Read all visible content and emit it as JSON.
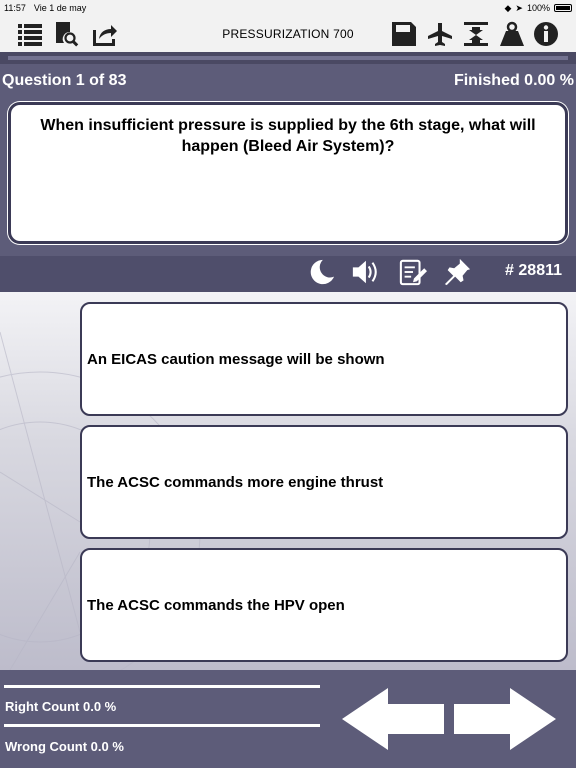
{
  "status_bar": {
    "time": "11:57",
    "date": "Vie 1 de may",
    "battery": "100%"
  },
  "toolbar": {
    "title": "PRESSURIZATION 700",
    "icons": [
      "list-icon",
      "document-search-icon",
      "share-icon",
      "save-icon",
      "airplane-icon",
      "compress-icon",
      "weight-icon",
      "info-icon"
    ]
  },
  "quiz": {
    "question_counter": "Question 1 of 83",
    "finished": "Finished 0.00 %",
    "question_text": "When insufficient pressure is supplied by the 6th stage, what will happen (Bleed Air System)?",
    "question_id": "# 28811"
  },
  "answers": [
    {
      "label": "An EICAS caution message will be shown"
    },
    {
      "label": "The ACSC commands more engine thrust"
    },
    {
      "label": "The ACSC commands the HPV open"
    }
  ],
  "stats": {
    "right_count": "Right Count 0.0  %",
    "wrong_count": "Wrong Count 0.0  %"
  },
  "colors": {
    "background": "#5d5c79",
    "box_border": "#3b3a56",
    "toolbar_bg": "#f2f2f2"
  }
}
